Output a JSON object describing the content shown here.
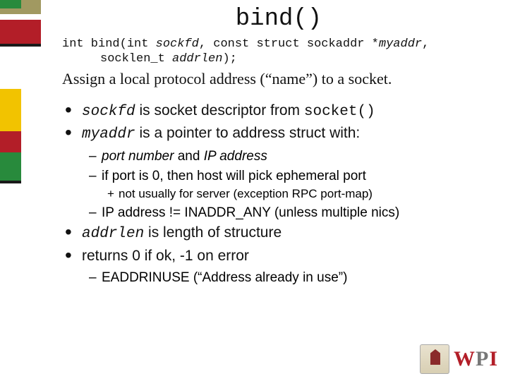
{
  "title": "bind()",
  "signature": {
    "line1_kw1": "int bind(int ",
    "line1_arg1": "sockfd",
    "line1_kw2": ", const struct sockaddr *",
    "line1_arg2": "myaddr",
    "line1_kw3": ",",
    "line2_kw1": "socklen_t ",
    "line2_arg1": "addrlen",
    "line2_kw2": ");"
  },
  "description": "Assign a local protocol address (“name”) to a socket.",
  "bullets1": {
    "b0": {
      "arg": "sockfd",
      "t1": " is socket descriptor from ",
      "code": "socket()"
    },
    "b1": {
      "arg": "myaddr",
      "t1": " is a pointer to address struct with:"
    }
  },
  "sub_b1": {
    "s0": {
      "pre": "",
      "em1": "port number",
      "mid": " and ",
      "em2": "IP address"
    },
    "s1": "if port is 0, then host will pick ephemeral port"
  },
  "sub2_b1": {
    "s0": "not usually for server (exception RPC port-map)"
  },
  "sub_b1b": {
    "s0": "IP address != INADDR_ANY (unless multiple nics)"
  },
  "bullets2": {
    "b0": {
      "arg": "addrlen",
      "t1": " is length of structure"
    },
    "b1": {
      "text": "returns 0 if ok, -1 on error"
    }
  },
  "sub_b2": {
    "s0": "EADDRINUSE (“Address already in use”)"
  },
  "logo": {
    "w": "W",
    "p": "P",
    "i": "I"
  }
}
